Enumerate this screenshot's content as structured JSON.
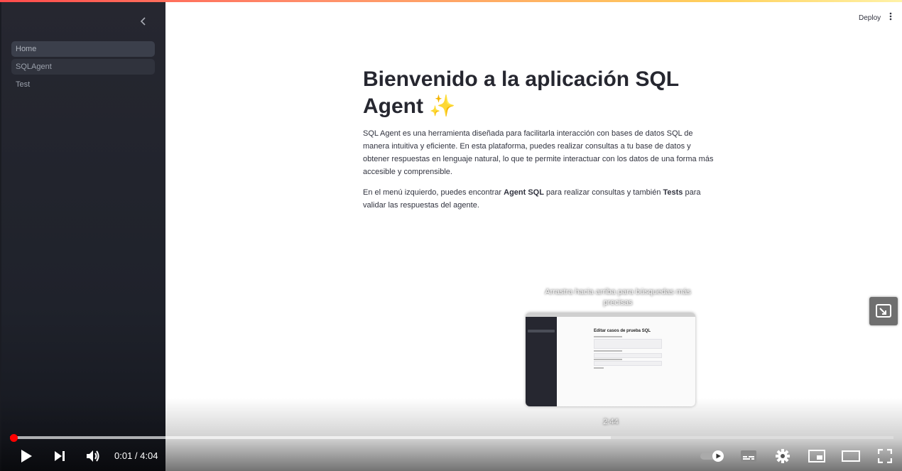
{
  "sidebar": {
    "collapse_icon": "chevron-left-icon",
    "items": [
      {
        "label": "Home",
        "state": "active"
      },
      {
        "label": "SQLAgent",
        "state": "hover"
      },
      {
        "label": "Test",
        "state": "normal"
      }
    ]
  },
  "header": {
    "deploy_label": "Deploy",
    "menu_icon": "kebab-menu-icon"
  },
  "main": {
    "title": "Bienvenido a la aplicación SQL Agent ✨",
    "paragraph1": "SQL Agent es una herramienta diseñada para facilitarla interacción con bases de datos SQL de manera intuitiva y eficiente. En esta plataforma, puedes realizar consultas a tu base de datos y obtener respuestas en lenguaje natural, lo que te permite interactuar con los datos de una forma más accesible y comprensible.",
    "paragraph2_prefix": "En el menú izquierdo, puedes encontrar ",
    "paragraph2_bold1": "Agent SQL",
    "paragraph2_mid": " para realizar consultas y también ",
    "paragraph2_bold2": "Tests",
    "paragraph2_suffix": " para validar las respuestas del agente."
  },
  "video_overlay": {
    "hint": "Arrastra hacia arriba para búsquedas más precisas",
    "preview_title": "Editar casos de prueba SQL",
    "preview_time": "2:44",
    "miniplayer_icon": "miniplayer-expand-icon"
  },
  "player": {
    "time_display": "0:01 / 4:04",
    "played_fraction": 0.004,
    "buffered_fraction": 0.68,
    "controls": [
      "play-icon",
      "next-icon",
      "volume-icon",
      "autoplay-toggle-icon",
      "subtitles-icon",
      "settings-icon",
      "miniplayer-icon",
      "theater-mode-icon",
      "fullscreen-icon"
    ]
  },
  "colors": {
    "progress": "#ff0000",
    "sidebar_bg": "#262730",
    "accent_line": "#ff4b4b"
  }
}
